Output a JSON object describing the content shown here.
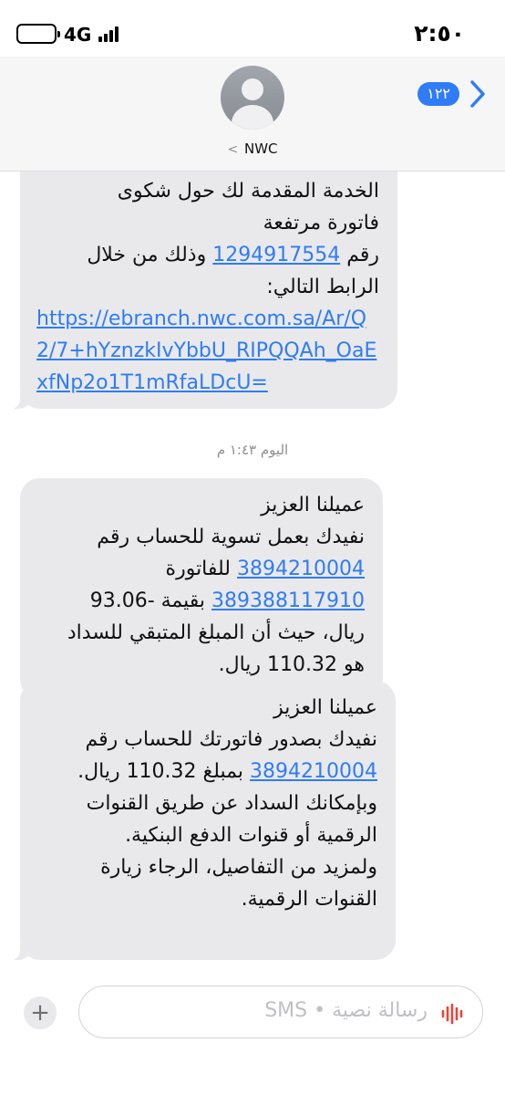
{
  "status_bar": {
    "time": "٢:٥٠",
    "network": "4G"
  },
  "header": {
    "back_count": "١٢٢",
    "contact_name": "NWC"
  },
  "messages": [
    {
      "line1": "الخدمة المقدمة لك حول شكوى",
      "line2": "فاتورة مرتفعة",
      "line3_prefix": "رقم",
      "complaint_number": "1294917554",
      "line3_suffix": "وذلك من خلال",
      "line4": "الرابط التالي:",
      "url": "https://ebranch.nwc.com.sa/Ar/Q2/7+hYznzkIvYbbU_RIPQQAh_OaExfNp2o1T1mRfaLDcU="
    },
    {
      "greeting": "عميلنا العزيز",
      "line1": "نفيدك بعمل تسوية للحساب رقم",
      "account_number": "3894210004",
      "after_account": "للفاتورة",
      "bill_number": "389388117910",
      "after_bill": "بقيمة -93.06",
      "line4": "ريال، حيث أن المبلغ المتبقي للسداد",
      "line5": "هو 110.32 ريال."
    },
    {
      "greeting": "عميلنا العزيز",
      "line1": "نفيدك بصدور فاتورتك للحساب رقم",
      "account_number": "3894210004",
      "after_account": "بمبلغ 110.32 ريال.",
      "line3": "وبإمكانك السداد عن طريق القنوات",
      "line4": "الرقمية أو قنوات الدفع البنكية.",
      "line5": "ولمزيد من التفاصيل، الرجاء زيارة",
      "line6": "القنوات الرقمية."
    }
  ],
  "timestamp": "اليوم ١:٤٣ م",
  "composer": {
    "placeholder": "رسالة نصية • SMS"
  },
  "colors": {
    "accent": "#2f7cf6",
    "bubble": "#e9e9eb",
    "header_bg": "#f6f6f7",
    "mic_red": "#e8453c"
  }
}
